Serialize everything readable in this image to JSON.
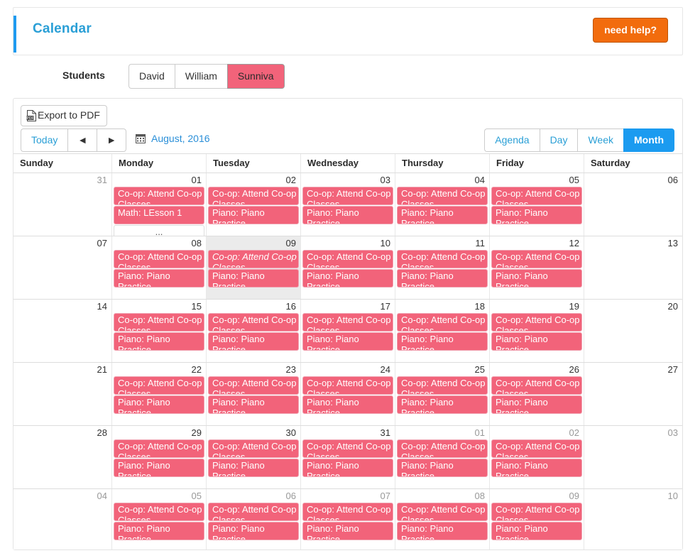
{
  "header": {
    "title": "Calendar",
    "help_button": "need help?",
    "accent_color": "#1e9bf0",
    "help_color": "#f26c0d"
  },
  "students": {
    "label": "Students",
    "items": [
      {
        "name": "David",
        "active": false
      },
      {
        "name": "William",
        "active": false
      },
      {
        "name": "Sunniva",
        "active": true
      }
    ],
    "active_color": "#f2637a"
  },
  "toolbar": {
    "export_label": "Export to PDF",
    "export_icon": "pdf-icon",
    "export_icon_text": "PDF",
    "today_label": "Today",
    "prev_label": "◄",
    "next_label": "►",
    "month_label": "August, 2016",
    "calendar_icon": "calendar-icon",
    "views": [
      {
        "label": "Agenda",
        "active": false
      },
      {
        "label": "Day",
        "active": false
      },
      {
        "label": "Week",
        "active": false
      },
      {
        "label": "Month",
        "active": true
      }
    ],
    "active_view_color": "#1b9bf0"
  },
  "calendar": {
    "day_headers": [
      "Sunday",
      "Monday",
      "Tuesday",
      "Wednesday",
      "Thursday",
      "Friday",
      "Saturday"
    ],
    "event_color": "#f2637a",
    "event_border_color": "#f0a2b1",
    "today_bg": "#ebebeb",
    "labels": {
      "coop": "Co-op: Attend Co-op Classes",
      "piano": "Piano: Piano Practice",
      "math": "Math: LEsson 1",
      "more": "..."
    },
    "weeks": [
      {
        "days": [
          {
            "num": "31",
            "other": true,
            "today": false,
            "events": []
          },
          {
            "num": "01",
            "other": false,
            "today": false,
            "events": [
              {
                "text": "Co-op: Attend Co-op Classes",
                "italic": false
              },
              {
                "text": "Math: LEsson 1",
                "italic": false
              }
            ],
            "more": "..."
          },
          {
            "num": "02",
            "other": false,
            "today": false,
            "events": [
              {
                "text": "Co-op: Attend Co-op Classes",
                "italic": false
              },
              {
                "text": "Piano: Piano Practice",
                "italic": false
              }
            ]
          },
          {
            "num": "03",
            "other": false,
            "today": false,
            "events": [
              {
                "text": "Co-op: Attend Co-op Classes",
                "italic": false
              },
              {
                "text": "Piano: Piano Practice",
                "italic": false
              }
            ]
          },
          {
            "num": "04",
            "other": false,
            "today": false,
            "events": [
              {
                "text": "Co-op: Attend Co-op Classes",
                "italic": false
              },
              {
                "text": "Piano: Piano Practice",
                "italic": false
              }
            ]
          },
          {
            "num": "05",
            "other": false,
            "today": false,
            "events": [
              {
                "text": "Co-op: Attend Co-op Classes",
                "italic": false
              },
              {
                "text": "Piano: Piano Practice",
                "italic": false
              }
            ]
          },
          {
            "num": "06",
            "other": false,
            "today": false,
            "events": []
          }
        ]
      },
      {
        "days": [
          {
            "num": "07",
            "other": false,
            "today": false,
            "events": []
          },
          {
            "num": "08",
            "other": false,
            "today": false,
            "events": [
              {
                "text": "Co-op: Attend Co-op Classes",
                "italic": false
              },
              {
                "text": "Piano: Piano Practice",
                "italic": false
              }
            ]
          },
          {
            "num": "09",
            "other": false,
            "today": true,
            "events": [
              {
                "text": "Co-op: Attend Co-op Classes",
                "italic": true
              },
              {
                "text": "Piano: Piano Practice",
                "italic": false
              }
            ]
          },
          {
            "num": "10",
            "other": false,
            "today": false,
            "events": [
              {
                "text": "Co-op: Attend Co-op Classes",
                "italic": false
              },
              {
                "text": "Piano: Piano Practice",
                "italic": false
              }
            ]
          },
          {
            "num": "11",
            "other": false,
            "today": false,
            "events": [
              {
                "text": "Co-op: Attend Co-op Classes",
                "italic": false
              },
              {
                "text": "Piano: Piano Practice",
                "italic": false
              }
            ]
          },
          {
            "num": "12",
            "other": false,
            "today": false,
            "events": [
              {
                "text": "Co-op: Attend Co-op Classes",
                "italic": false
              },
              {
                "text": "Piano: Piano Practice",
                "italic": false
              }
            ]
          },
          {
            "num": "13",
            "other": false,
            "today": false,
            "events": []
          }
        ]
      },
      {
        "days": [
          {
            "num": "14",
            "other": false,
            "today": false,
            "events": []
          },
          {
            "num": "15",
            "other": false,
            "today": false,
            "events": [
              {
                "text": "Co-op: Attend Co-op Classes",
                "italic": false
              },
              {
                "text": "Piano: Piano Practice",
                "italic": false
              }
            ]
          },
          {
            "num": "16",
            "other": false,
            "today": false,
            "events": [
              {
                "text": "Co-op: Attend Co-op Classes",
                "italic": false
              },
              {
                "text": "Piano: Piano Practice",
                "italic": false
              }
            ]
          },
          {
            "num": "17",
            "other": false,
            "today": false,
            "events": [
              {
                "text": "Co-op: Attend Co-op Classes",
                "italic": false
              },
              {
                "text": "Piano: Piano Practice",
                "italic": false
              }
            ]
          },
          {
            "num": "18",
            "other": false,
            "today": false,
            "events": [
              {
                "text": "Co-op: Attend Co-op Classes",
                "italic": false
              },
              {
                "text": "Piano: Piano Practice",
                "italic": false
              }
            ]
          },
          {
            "num": "19",
            "other": false,
            "today": false,
            "events": [
              {
                "text": "Co-op: Attend Co-op Classes",
                "italic": false
              },
              {
                "text": "Piano: Piano Practice",
                "italic": false
              }
            ]
          },
          {
            "num": "20",
            "other": false,
            "today": false,
            "events": []
          }
        ]
      },
      {
        "days": [
          {
            "num": "21",
            "other": false,
            "today": false,
            "events": []
          },
          {
            "num": "22",
            "other": false,
            "today": false,
            "events": [
              {
                "text": "Co-op: Attend Co-op Classes",
                "italic": false
              },
              {
                "text": "Piano: Piano Practice",
                "italic": false
              }
            ]
          },
          {
            "num": "23",
            "other": false,
            "today": false,
            "events": [
              {
                "text": "Co-op: Attend Co-op Classes",
                "italic": false
              },
              {
                "text": "Piano: Piano Practice",
                "italic": false
              }
            ]
          },
          {
            "num": "24",
            "other": false,
            "today": false,
            "events": [
              {
                "text": "Co-op: Attend Co-op Classes",
                "italic": false
              },
              {
                "text": "Piano: Piano Practice",
                "italic": false
              }
            ]
          },
          {
            "num": "25",
            "other": false,
            "today": false,
            "events": [
              {
                "text": "Co-op: Attend Co-op Classes",
                "italic": false
              },
              {
                "text": "Piano: Piano Practice",
                "italic": false
              }
            ]
          },
          {
            "num": "26",
            "other": false,
            "today": false,
            "events": [
              {
                "text": "Co-op: Attend Co-op Classes",
                "italic": false
              },
              {
                "text": "Piano: Piano Practice",
                "italic": false
              }
            ]
          },
          {
            "num": "27",
            "other": false,
            "today": false,
            "events": []
          }
        ]
      },
      {
        "days": [
          {
            "num": "28",
            "other": false,
            "today": false,
            "events": []
          },
          {
            "num": "29",
            "other": false,
            "today": false,
            "events": [
              {
                "text": "Co-op: Attend Co-op Classes",
                "italic": false
              },
              {
                "text": "Piano: Piano Practice",
                "italic": false
              }
            ]
          },
          {
            "num": "30",
            "other": false,
            "today": false,
            "events": [
              {
                "text": "Co-op: Attend Co-op Classes",
                "italic": false
              },
              {
                "text": "Piano: Piano Practice",
                "italic": false
              }
            ]
          },
          {
            "num": "31",
            "other": false,
            "today": false,
            "events": [
              {
                "text": "Co-op: Attend Co-op Classes",
                "italic": false
              },
              {
                "text": "Piano: Piano Practice",
                "italic": false
              }
            ]
          },
          {
            "num": "01",
            "other": true,
            "today": false,
            "events": [
              {
                "text": "Co-op: Attend Co-op Classes",
                "italic": false
              },
              {
                "text": "Piano: Piano Practice",
                "italic": false
              }
            ]
          },
          {
            "num": "02",
            "other": true,
            "today": false,
            "events": [
              {
                "text": "Co-op: Attend Co-op Classes",
                "italic": false
              },
              {
                "text": "Piano: Piano Practice",
                "italic": false
              }
            ]
          },
          {
            "num": "03",
            "other": true,
            "today": false,
            "events": []
          }
        ]
      },
      {
        "days": [
          {
            "num": "04",
            "other": true,
            "today": false,
            "events": []
          },
          {
            "num": "05",
            "other": true,
            "today": false,
            "events": [
              {
                "text": "Co-op: Attend Co-op Classes",
                "italic": false
              },
              {
                "text": "Piano: Piano Practice",
                "italic": false
              }
            ]
          },
          {
            "num": "06",
            "other": true,
            "today": false,
            "events": [
              {
                "text": "Co-op: Attend Co-op Classes",
                "italic": false
              },
              {
                "text": "Piano: Piano Practice",
                "italic": false
              }
            ]
          },
          {
            "num": "07",
            "other": true,
            "today": false,
            "events": [
              {
                "text": "Co-op: Attend Co-op Classes",
                "italic": false
              },
              {
                "text": "Piano: Piano Practice",
                "italic": false
              }
            ]
          },
          {
            "num": "08",
            "other": true,
            "today": false,
            "events": [
              {
                "text": "Co-op: Attend Co-op Classes",
                "italic": false
              },
              {
                "text": "Piano: Piano Practice",
                "italic": false
              }
            ]
          },
          {
            "num": "09",
            "other": true,
            "today": false,
            "events": [
              {
                "text": "Co-op: Attend Co-op Classes",
                "italic": false
              },
              {
                "text": "Piano: Piano Practice",
                "italic": false
              }
            ]
          },
          {
            "num": "10",
            "other": true,
            "today": false,
            "events": []
          }
        ]
      }
    ]
  }
}
